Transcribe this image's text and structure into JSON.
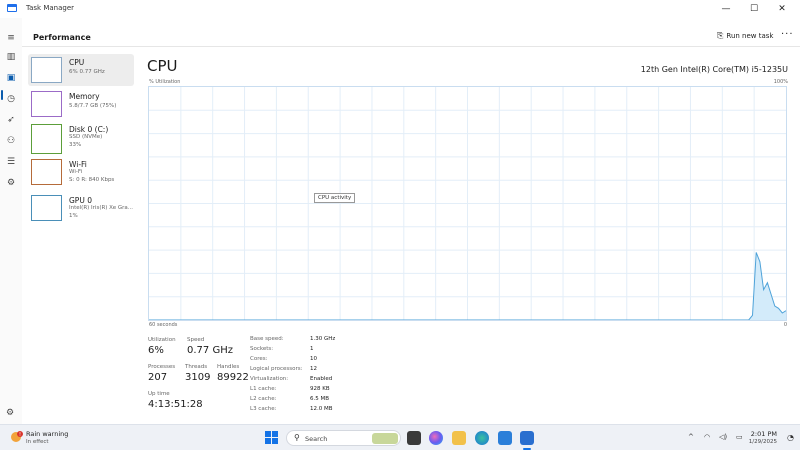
{
  "window": {
    "title": "Task Manager",
    "controls": {
      "minimize": "—",
      "maximize": "☐",
      "close": "✕"
    }
  },
  "rail": {
    "icons": [
      "menu-icon",
      "processes-icon",
      "performance-icon",
      "app-history-icon",
      "startup-apps-icon",
      "users-icon",
      "details-icon",
      "services-icon",
      "settings-icon"
    ],
    "active": "performance-icon"
  },
  "header": {
    "title": "Performance",
    "run_new_task": "Run new task",
    "more": "···"
  },
  "devices": [
    {
      "name": "CPU",
      "sub1": "6% 0.77 GHz",
      "sub2": ""
    },
    {
      "name": "Memory",
      "sub1": "5.8/7.7 GB (75%)",
      "sub2": ""
    },
    {
      "name": "Disk 0 (C:)",
      "sub1": "SSD (NVMe)",
      "sub2": "33%"
    },
    {
      "name": "Wi-Fi",
      "sub1": "Wi-Fi",
      "sub2": "S: 0 R: 840 Kbps"
    },
    {
      "name": "GPU 0",
      "sub1": "Intel(R) Iris(R) Xe Gra...",
      "sub2": "1%"
    }
  ],
  "cpu": {
    "title": "CPU",
    "model": "12th Gen Intel(R) Core(TM) i5-1235U",
    "util_label": "% Utilization",
    "util_max": "100%",
    "time_span": "60 seconds",
    "util_min": "0",
    "tooltip": "CPU activity",
    "usage_series": [
      0,
      0,
      0,
      0,
      0,
      0,
      0,
      0,
      0,
      0,
      0,
      0,
      0,
      0,
      0,
      0,
      0,
      0,
      0,
      0,
      0,
      0,
      0,
      0,
      0,
      0,
      0,
      0,
      0,
      0,
      0,
      0,
      0,
      0,
      0,
      0,
      0,
      0,
      0,
      0,
      0,
      0,
      0,
      0,
      0,
      0,
      0,
      0,
      0,
      0,
      0,
      0,
      0,
      0,
      0,
      0,
      0,
      0,
      0,
      0,
      0,
      0,
      0,
      0,
      0,
      0,
      0,
      0,
      0,
      0,
      0,
      0,
      0,
      0,
      0,
      0,
      0,
      0,
      0,
      0,
      0,
      0,
      0,
      0,
      0,
      0,
      0,
      0,
      0,
      0,
      0,
      0,
      0,
      0,
      0,
      0,
      0,
      0,
      0,
      0,
      0,
      0,
      0,
      0,
      0,
      0,
      0,
      0,
      0,
      0,
      0,
      0,
      0,
      0,
      0,
      0,
      0,
      0,
      0,
      0,
      0,
      0,
      0,
      0,
      0,
      0,
      0,
      0,
      0,
      0,
      0,
      0,
      0,
      0,
      0,
      0,
      0,
      0,
      0,
      0,
      0,
      0,
      0,
      0,
      0,
      0,
      0,
      0,
      0,
      0,
      0,
      0,
      0,
      0,
      0,
      0,
      0,
      0,
      0,
      0,
      0,
      0,
      2,
      29,
      25,
      13,
      16,
      11,
      6,
      5,
      3,
      4
    ],
    "stats": {
      "utilization": {
        "label": "Utilization",
        "value": "6%"
      },
      "speed": {
        "label": "Speed",
        "value": "0.77 GHz"
      },
      "processes": {
        "label": "Processes",
        "value": "207"
      },
      "threads": {
        "label": "Threads",
        "value": "3109"
      },
      "handles": {
        "label": "Handles",
        "value": "89922"
      },
      "uptime": {
        "label": "Up time",
        "value": "4:13:51:28"
      }
    },
    "specs": [
      {
        "label": "Base speed:",
        "value": "1.30 GHz"
      },
      {
        "label": "Sockets:",
        "value": "1"
      },
      {
        "label": "Cores:",
        "value": "10"
      },
      {
        "label": "Logical processors:",
        "value": "12"
      },
      {
        "label": "Virtualization:",
        "value": "Enabled"
      },
      {
        "label": "L1 cache:",
        "value": "928 KB"
      },
      {
        "label": "L2 cache:",
        "value": "6.5 MB"
      },
      {
        "label": "L3 cache:",
        "value": "12.0 MB"
      }
    ]
  },
  "taskbar": {
    "weather_title": "Rain warning",
    "weather_sub": "In effect",
    "search_label": "Search",
    "clock_time": "2:01 PM",
    "clock_date": "1/29/2025",
    "tray": {
      "chevron": "^",
      "wifi": "wifi-icon",
      "volume": "volume-icon",
      "battery": "battery-icon"
    }
  },
  "colors": {
    "accent": "#0b5cad",
    "graph_border": "#c9ddf0",
    "graph_fill": "#d3ebfa",
    "graph_line": "#4fa3d9"
  }
}
